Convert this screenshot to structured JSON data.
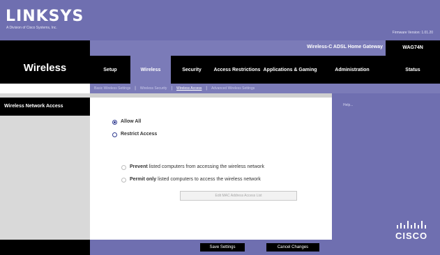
{
  "brand": {
    "logo_text": "LINKSYS",
    "logo_sub": "A Division of Cisco Systems, Inc.",
    "firmware": "Firmware Version: 1.01.20"
  },
  "product": {
    "name": "Wireless-C ADSL Home Gateway",
    "model": "WAG74N"
  },
  "section": {
    "title": "Wireless"
  },
  "tabs": [
    {
      "label": "Setup"
    },
    {
      "label": "Wireless"
    },
    {
      "label": "Security"
    },
    {
      "label": "Access Restrictions"
    },
    {
      "label": "Applications & Gaming"
    },
    {
      "label": "Administration"
    },
    {
      "label": "Status"
    }
  ],
  "subtabs": [
    {
      "label": "Basic Wireless Settings"
    },
    {
      "label": "Wireless Security"
    },
    {
      "label": "Wireless Access"
    },
    {
      "label": "Advanced Wireless Settings"
    }
  ],
  "page": {
    "left_label": "Wireless Network Access",
    "allow_all": "Allow All",
    "restrict": "Restrict Access",
    "prevent_bold": "Prevent",
    "prevent_text": "listed computers from accessing the wireless network",
    "permit_bold": "Permit only",
    "permit_text": "listed computers to access the wireless network",
    "mac_button": "Edit MAC Address Access List",
    "help": "Help..."
  },
  "footer": {
    "save": "Save Settings",
    "cancel": "Cancel Changes"
  },
  "brand_footer": {
    "cisco": "CISCO"
  },
  "colors": {
    "accent": "#7b7bb8",
    "header": "#6f6fb0",
    "radio": "#2e3a8f"
  }
}
